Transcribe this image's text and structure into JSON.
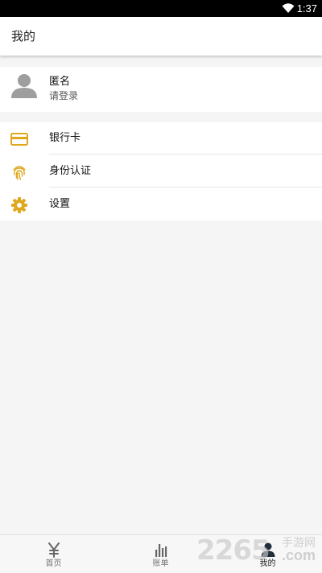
{
  "status_bar": {
    "time": "1:37",
    "wifi_icon": "wifi-icon"
  },
  "app_bar": {
    "title": "我的"
  },
  "profile": {
    "name": "匿名",
    "hint": "请登录",
    "avatar_icon": "avatar-icon"
  },
  "menu": {
    "items": [
      {
        "label": "银行卡",
        "icon": "credit-card-icon"
      },
      {
        "label": "身份认证",
        "icon": "fingerprint-icon"
      },
      {
        "label": "设置",
        "icon": "gear-icon"
      }
    ],
    "accent": "#e0a81e"
  },
  "tabs": [
    {
      "label": "首页",
      "icon": "yen-icon",
      "active": false
    },
    {
      "label": "账单",
      "icon": "bar-chart-icon",
      "active": false
    },
    {
      "label": "我的",
      "icon": "person-icon",
      "active": true
    }
  ],
  "watermark": {
    "number": "2265",
    "cn": "手游网",
    "com": ".com"
  }
}
